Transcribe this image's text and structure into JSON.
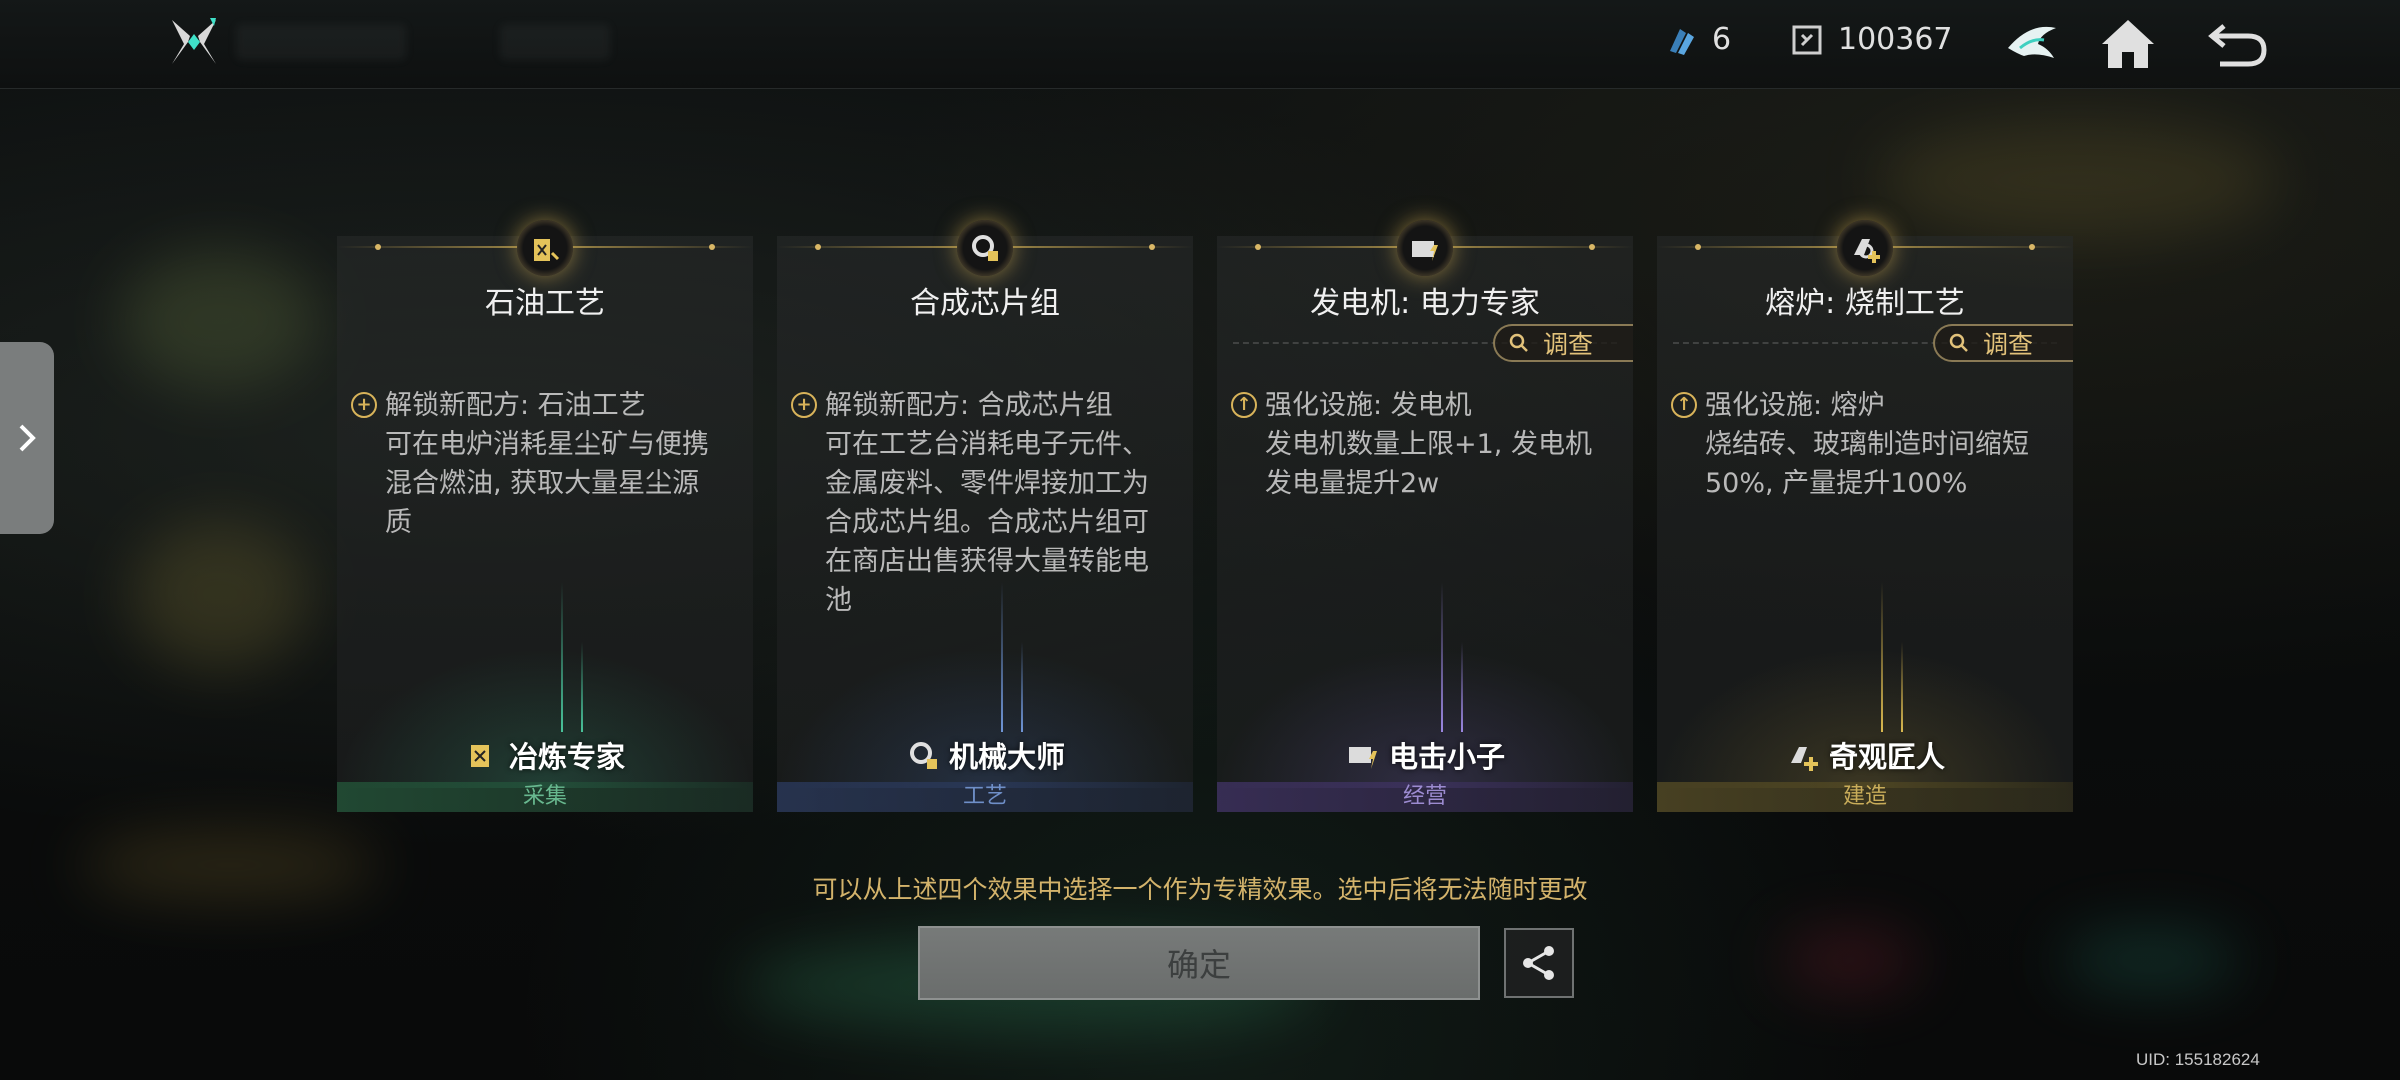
{
  "topbar": {
    "resource1_value": "6",
    "resource2_value": "100367",
    "icons": [
      "logo-icon",
      "crystal-icon",
      "currency-icon",
      "bird-emblem-icon",
      "home-icon",
      "back-icon"
    ]
  },
  "cards": [
    {
      "title": "石油工艺",
      "investigate": "",
      "bullet_type": "plus",
      "desc_lines": [
        "解锁新配方: 石油工艺",
        "可在电炉消耗星尘矿与便携",
        "混合燃油, 获取大量星尘源",
        "质"
      ],
      "role": "冶炼专家",
      "category": "采集",
      "accent": "#49c29a"
    },
    {
      "title": "合成芯片组",
      "investigate": "",
      "bullet_type": "plus",
      "desc_lines": [
        "解锁新配方: 合成芯片组",
        "可在工艺台消耗电子元件、",
        "金属废料、零件焊接加工为",
        "合成芯片组。合成芯片组可",
        "在商店出售获得大量转能电",
        "池"
      ],
      "role": "机械大师",
      "category": "工艺",
      "accent": "#5f8fd9"
    },
    {
      "title": "发电机: 电力专家",
      "investigate": "调查",
      "bullet_type": "up",
      "desc_lines": [
        "强化设施: 发电机",
        "发电机数量上限+1, 发电机",
        "发电量提升2w"
      ],
      "role": "电击小子",
      "category": "经营",
      "accent": "#9a86e0"
    },
    {
      "title": "熔炉: 烧制工艺",
      "investigate": "调查",
      "bullet_type": "up",
      "desc_lines": [
        "强化设施: 熔炉",
        "烧结砖、玻璃制造时间缩短",
        "50%, 产量提升100%"
      ],
      "role": "奇观匠人",
      "category": "建造",
      "accent": "#d9b84f"
    }
  ],
  "footer": {
    "hint": "可以从上述四个效果中选择一个作为专精效果。选中后将无法随时更改",
    "confirm_label": "确定",
    "uid": "UID: 155182624"
  }
}
